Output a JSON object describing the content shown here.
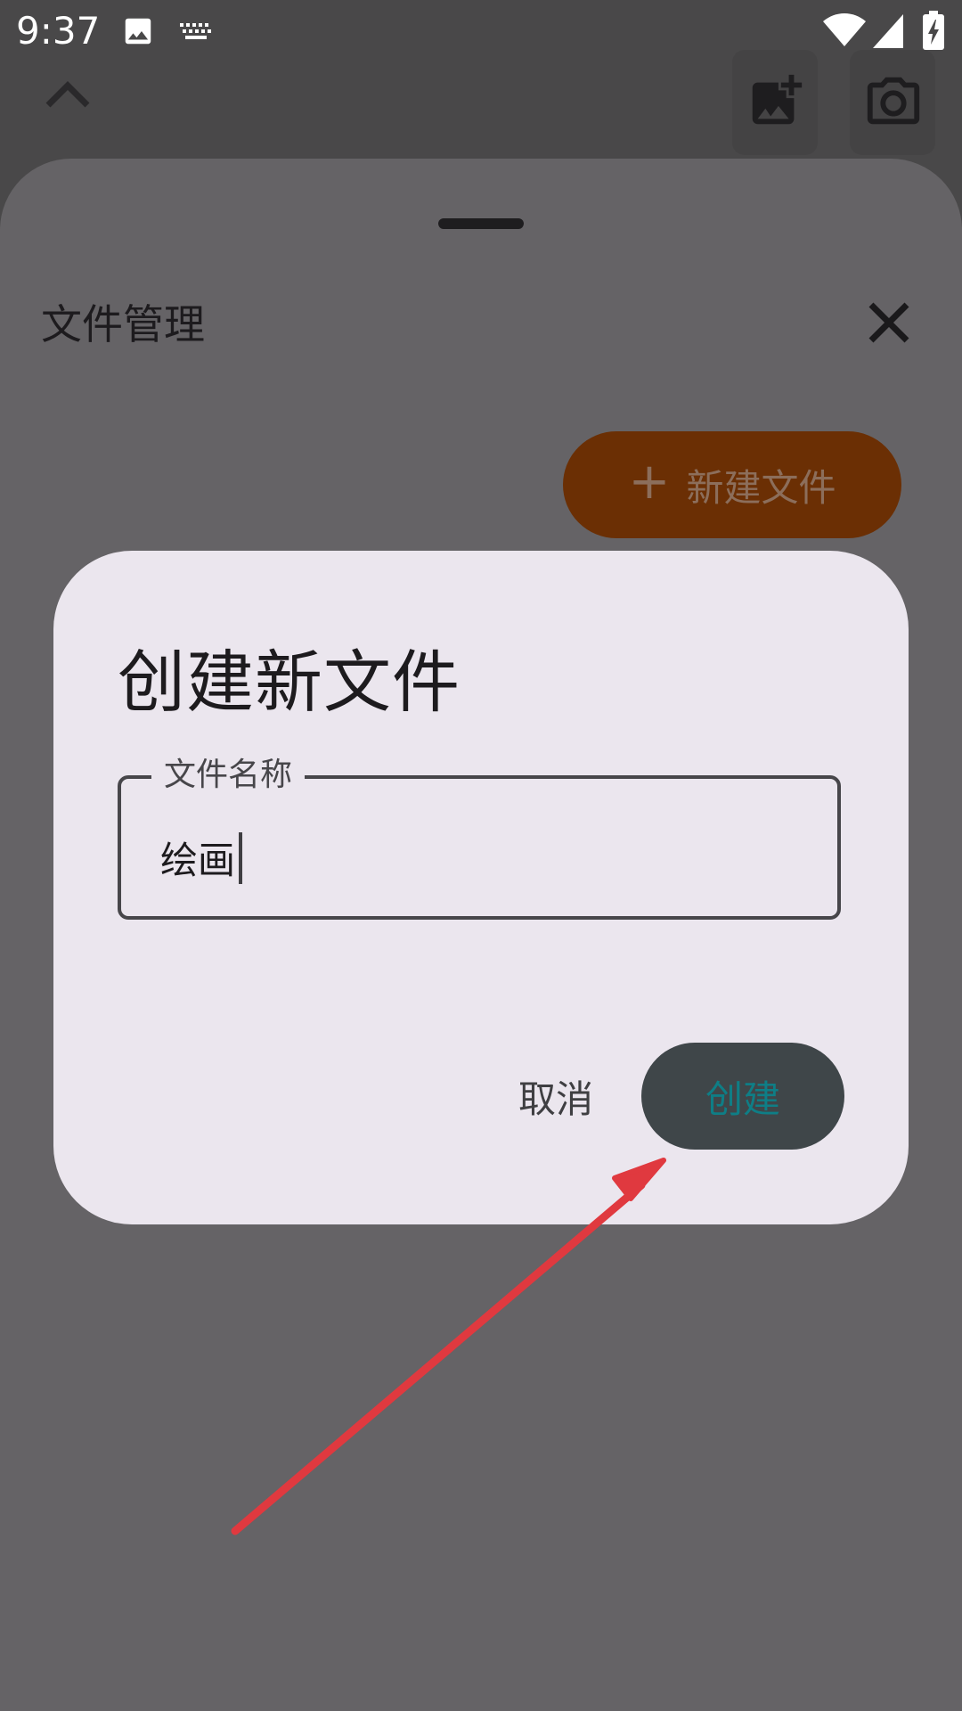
{
  "status_bar": {
    "time": "9:37",
    "icons": [
      "image-icon",
      "keyboard-icon",
      "wifi-icon",
      "signal-icon",
      "battery-charging-icon"
    ]
  },
  "toolbar": {
    "buttons": [
      "add-photo-icon",
      "camera-icon"
    ],
    "expand_icon": "chevron-up-icon"
  },
  "sheet": {
    "title": "文件管理",
    "close_icon": "close-icon",
    "new_file_button": {
      "icon": "plus-icon",
      "label": "新建文件"
    }
  },
  "dialog": {
    "title": "创建新文件",
    "field": {
      "label": "文件名称",
      "value": "绘画"
    },
    "cancel_label": "取消",
    "create_label": "创建"
  },
  "colors": {
    "scrim": "#656366",
    "dialog_bg": "#ebe6ee",
    "new_file_button_bg": "#6b2f04",
    "create_button_bg": "#3f4649",
    "create_text": "#0e7e86",
    "annotation_arrow": "#e0393f"
  }
}
